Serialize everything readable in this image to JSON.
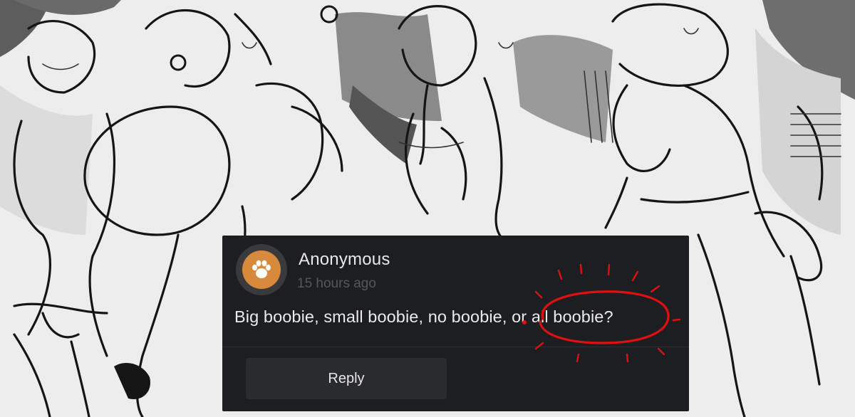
{
  "comment": {
    "author": "Anonymous",
    "timestamp": "15 hours ago",
    "text": "Big boobie, small boobie, no boobie, or all boobie?",
    "reply_label": "Reply"
  },
  "colors": {
    "card_background": "#1d1e21",
    "avatar_ring": "#3a3a3d",
    "avatar_fill": "#d88a3c",
    "markup_red": "#e01010",
    "reply_button": "#2a2b2f"
  },
  "icons": {
    "avatar": "paw-icon"
  }
}
